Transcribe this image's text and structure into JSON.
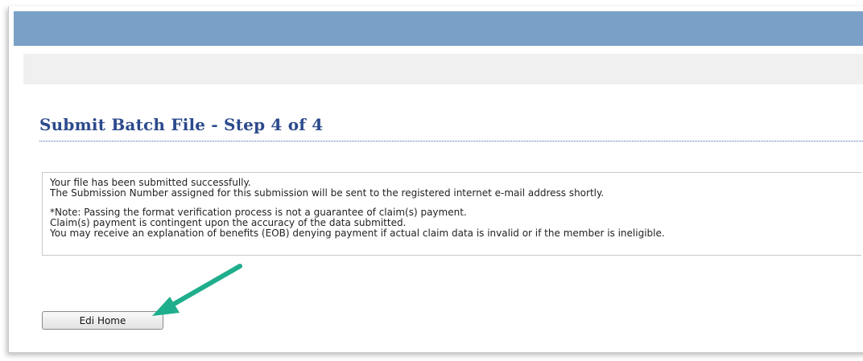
{
  "page": {
    "title": "Submit Batch File - Step 4 of 4"
  },
  "message": {
    "lines": [
      "Your file has been submitted successfully.",
      "The Submission Number assigned for this submission will be sent to the registered internet e-mail address shortly.",
      "*Note: Passing the format verification process is not a guarantee of claim(s) payment.",
      "Claim(s) payment is contingent upon the accuracy of the data submitted.",
      "You may receive an explanation of benefits (EOB) denying payment if actual claim data is invalid or if the member is ineligible."
    ]
  },
  "buttons": {
    "edi_home_label": "Edi Home"
  },
  "annotation": {
    "arrow_icon": "arrow-pointing-to-button-icon",
    "arrow_color": "#1fae8c"
  },
  "colors": {
    "header_bar": "#7ba0c7",
    "subheader_bar": "#f0f0f0",
    "title": "#2c4a8c"
  }
}
